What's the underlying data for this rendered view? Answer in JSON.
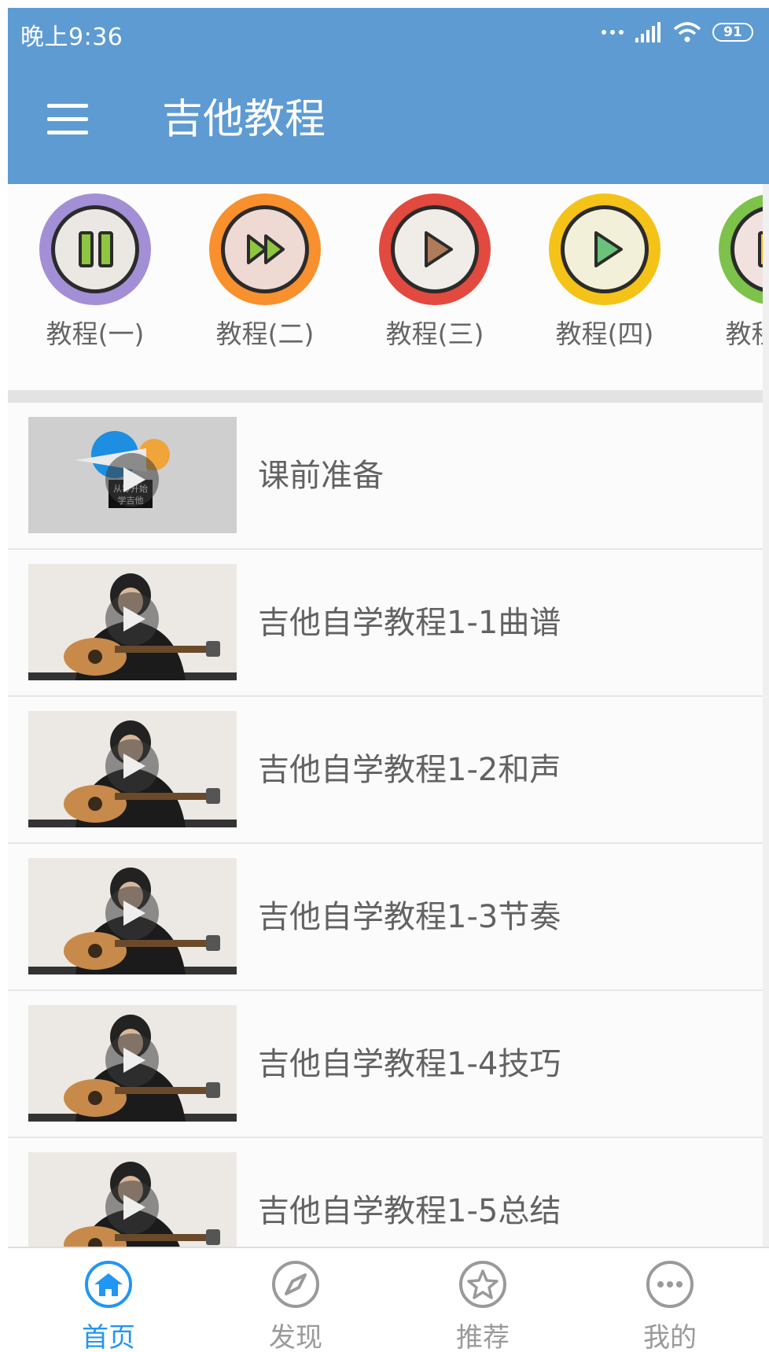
{
  "status": {
    "time": "晚上9:36",
    "battery": "91"
  },
  "appbar": {
    "title": "吉他教程",
    "menu_icon": "menu-icon"
  },
  "categories": [
    {
      "label": "教程(一)",
      "ring": "#a38fd6",
      "fill": "#ebe8e4",
      "icon": "pause-icon",
      "icon_color": "#8ec63f"
    },
    {
      "label": "教程(二)",
      "ring": "#f7902d",
      "fill": "#efd9d3",
      "icon": "fast-forward-icon",
      "icon_color": "#8ec63f"
    },
    {
      "label": "教程(三)",
      "ring": "#e2493f",
      "fill": "#f0ede8",
      "icon": "play-icon",
      "icon_color": "#b07b5a"
    },
    {
      "label": "教程(四)",
      "ring": "#f5c218",
      "fill": "#f3f0d9",
      "icon": "play-icon",
      "icon_color": "#6bc27a"
    },
    {
      "label": "教程(五)",
      "ring": "#7dc24a",
      "fill": "#f2e2df",
      "icon": "pause-icon",
      "icon_color": "#f5c218"
    }
  ],
  "lessons": [
    {
      "title": "课前准备",
      "thumb": "intro"
    },
    {
      "title": "吉他自学教程1-1曲谱",
      "thumb": "guitar"
    },
    {
      "title": "吉他自学教程1-2和声",
      "thumb": "guitar"
    },
    {
      "title": "吉他自学教程1-3节奏",
      "thumb": "guitar"
    },
    {
      "title": "吉他自学教程1-4技巧",
      "thumb": "guitar"
    },
    {
      "title": "吉他自学教程1-5总结",
      "thumb": "guitar"
    }
  ],
  "bottom_nav": [
    {
      "label": "首页",
      "icon": "home-icon",
      "active": true
    },
    {
      "label": "发现",
      "icon": "compass-icon",
      "active": false
    },
    {
      "label": "推荐",
      "icon": "star-icon",
      "active": false
    },
    {
      "label": "我的",
      "icon": "more-icon",
      "active": false
    }
  ],
  "colors": {
    "primary": "#5e9bd3",
    "nav_active": "#2196f3",
    "nav_inactive": "#9a9a9a"
  }
}
